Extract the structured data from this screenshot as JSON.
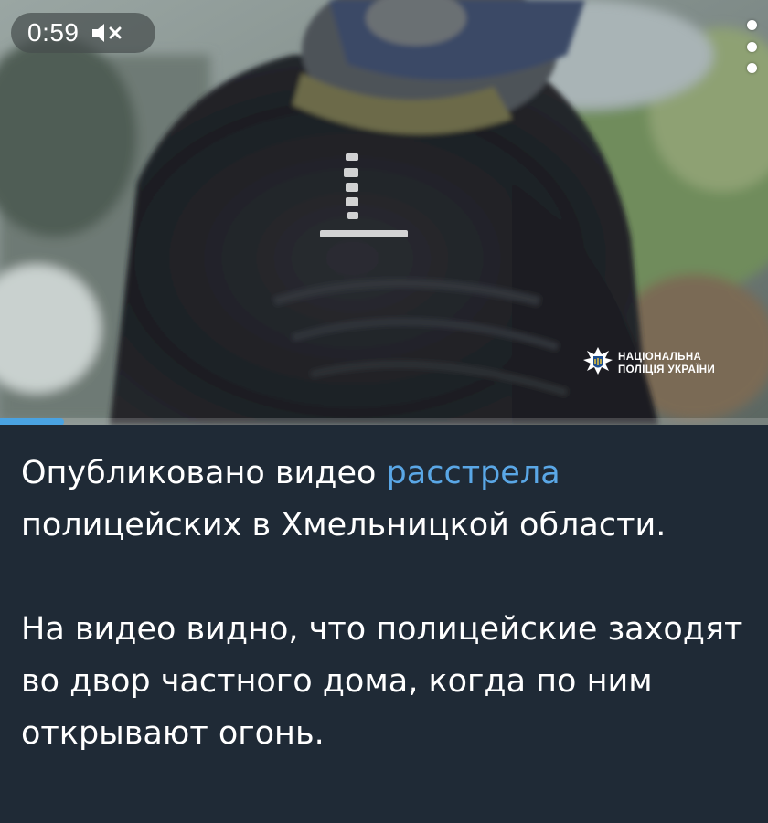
{
  "video": {
    "time": "0:59",
    "muted_icon": "volume-muted-icon",
    "menu_icon": "more-vertical-icon",
    "watermark": {
      "line1": "НАЦІОНАЛЬНА",
      "line2": "ПОЛІЦІЯ УКРАЇНИ",
      "emblem_icon": "police-emblem-icon"
    },
    "progress_fraction": 0.083,
    "colors": {
      "progress": "#4aa3e2",
      "pill_bg": "#464e4e"
    }
  },
  "message": {
    "para1_start": "Опубликовано видео ",
    "para1_link": "расстрела",
    "para1_end": " полицейских в Хмельницкой области.",
    "para2": "На видео видно, что полицейские заходят во двор частного дома, когда по ним открывают огонь."
  },
  "colors": {
    "background": "#1f2a36",
    "text": "#ffffff",
    "link": "#5aa7e6"
  }
}
